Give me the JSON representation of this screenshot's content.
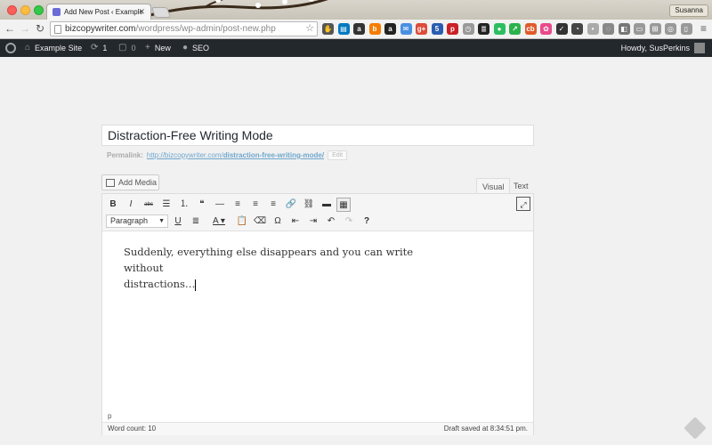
{
  "browser": {
    "tab_title": "Add New Post ‹ Example Si",
    "tab_close": "✕",
    "profile_name": "Susanna",
    "url_host": "bizcopywriter.com",
    "url_path": "/wordpress/wp-admin/post-new.php",
    "star": "☆",
    "menu": "≡",
    "nav": {
      "back": "←",
      "forward": "→",
      "reload": "↻"
    },
    "extensions": [
      {
        "icon": "hand-icon",
        "color": "#555555",
        "glyph": "✋"
      },
      {
        "icon": "trello-icon",
        "color": "#0079bf",
        "glyph": "▤"
      },
      {
        "icon": "amazon-icon",
        "color": "#333333",
        "glyph": "a"
      },
      {
        "icon": "blogger-icon",
        "color": "#f57d00",
        "glyph": "b"
      },
      {
        "icon": "amazon-smile-icon",
        "color": "#222222",
        "glyph": "a"
      },
      {
        "icon": "mail-icon",
        "color": "#4a90e2",
        "glyph": "✉"
      },
      {
        "icon": "google-plus-icon",
        "color": "#dd4b39",
        "glyph": "g+"
      },
      {
        "icon": "five-icon",
        "color": "#2a5db0",
        "glyph": "5"
      },
      {
        "icon": "pinterest-icon",
        "color": "#cb2027",
        "glyph": "p"
      },
      {
        "icon": "wayback-icon",
        "color": "#999999",
        "glyph": "◷"
      },
      {
        "icon": "buffer-icon",
        "color": "#222222",
        "glyph": "≣"
      },
      {
        "icon": "evernote-icon",
        "color": "#2dbe60",
        "glyph": "●"
      },
      {
        "icon": "feedly-icon",
        "color": "#2bb24c",
        "glyph": "↗"
      },
      {
        "icon": "cb-icon",
        "color": "#e05a2b",
        "glyph": "cb"
      },
      {
        "icon": "color-wheel-icon",
        "color": "#e94b8a",
        "glyph": "✿"
      },
      {
        "icon": "todo-icon",
        "color": "#333333",
        "glyph": "✓"
      },
      {
        "icon": "speed-icon",
        "color": "#444444",
        "glyph": "◔"
      },
      {
        "icon": "dot-icon",
        "color": "#aaaaaa",
        "glyph": "•"
      },
      {
        "icon": "pocket-icon",
        "color": "#888888",
        "glyph": "◌"
      },
      {
        "icon": "shield-icon",
        "color": "#777777",
        "glyph": "◧"
      },
      {
        "icon": "window-icon",
        "color": "#999999",
        "glyph": "▭"
      },
      {
        "icon": "capture-icon",
        "color": "#999999",
        "glyph": "⊞"
      },
      {
        "icon": "ring-icon",
        "color": "#999999",
        "glyph": "◎"
      },
      {
        "icon": "tablet-icon",
        "color": "#999999",
        "glyph": "▯"
      }
    ]
  },
  "adminbar": {
    "site_name": "Example Site",
    "updates_count": "1",
    "comments_count": "0",
    "new_label": "New",
    "seo_label": "SEO",
    "howdy": "Howdy, SusPerkins"
  },
  "editor": {
    "post_title": "Distraction-Free Writing Mode",
    "permalink_label": "Permalink:",
    "permalink_base": "http://bizcopywriter.com/",
    "permalink_slug": "distraction-free-writing-mode/",
    "permalink_edit": "Edit",
    "add_media": "Add Media",
    "tab_visual": "Visual",
    "tab_text": "Text",
    "format_select": "Paragraph",
    "body_line1": "Suddenly, everything else disappears and you can write without",
    "body_line2": "distractions…",
    "path": "p",
    "word_count": "Word count: 10",
    "draft_saved": "Draft saved at 8:34:51 pm."
  },
  "toolbar_row1": [
    {
      "name": "bold-button",
      "glyph": "B"
    },
    {
      "name": "italic-button",
      "glyph": "I"
    },
    {
      "name": "strikethrough-button",
      "glyph": "abc"
    },
    {
      "name": "bullet-list-button",
      "glyph": "☰"
    },
    {
      "name": "numbered-list-button",
      "glyph": "⒈"
    },
    {
      "name": "blockquote-button",
      "glyph": "❝"
    },
    {
      "name": "horizontal-rule-button",
      "glyph": "—"
    },
    {
      "name": "align-left-button",
      "glyph": "≡"
    },
    {
      "name": "align-center-button",
      "glyph": "≡"
    },
    {
      "name": "align-right-button",
      "glyph": "≡"
    },
    {
      "name": "insert-link-button",
      "glyph": "🔗"
    },
    {
      "name": "remove-link-button",
      "glyph": "⛓"
    },
    {
      "name": "read-more-button",
      "glyph": "▬"
    },
    {
      "name": "toolbar-toggle-button",
      "glyph": "▦"
    }
  ],
  "toolbar_row2": [
    {
      "name": "underline-button",
      "glyph": "U"
    },
    {
      "name": "justify-button",
      "glyph": "≣"
    },
    {
      "name": "text-color-button",
      "glyph": "A"
    },
    {
      "name": "paste-text-button",
      "glyph": "📋"
    },
    {
      "name": "clear-formatting-button",
      "glyph": "⌫"
    },
    {
      "name": "special-character-button",
      "glyph": "Ω"
    },
    {
      "name": "outdent-button",
      "glyph": "⇤"
    },
    {
      "name": "indent-button",
      "glyph": "⇥"
    },
    {
      "name": "undo-button",
      "glyph": "↶"
    },
    {
      "name": "redo-button",
      "glyph": "↷"
    },
    {
      "name": "help-button",
      "glyph": "?"
    }
  ],
  "fullscreen_glyph": "⤢",
  "colors": {
    "adminbar": "#23282d",
    "link": "#6ea6cd",
    "page_bg": "#f1f1f1"
  }
}
